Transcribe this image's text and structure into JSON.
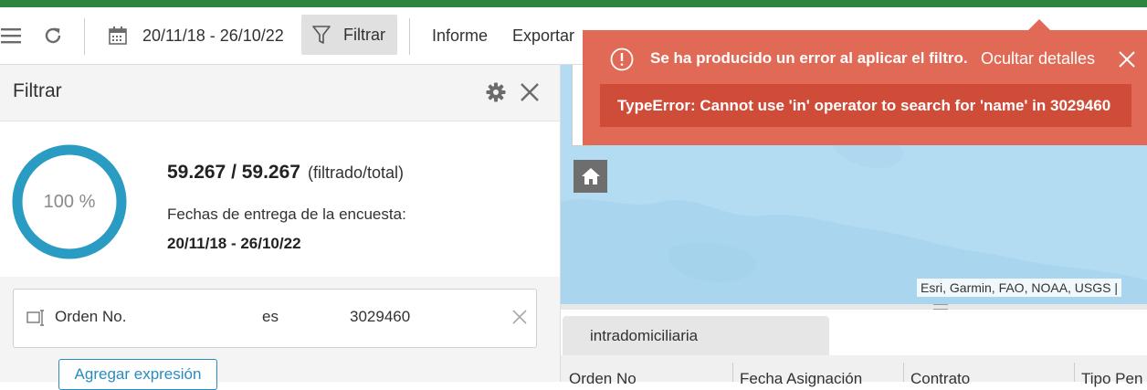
{
  "toolbar": {
    "menu_icon": "hamburger-menu-icon",
    "refresh_icon": "refresh-icon",
    "calendar_icon": "calendar-icon",
    "date_range": "20/11/18 - 26/10/22",
    "filter_icon": "funnel-filter-icon",
    "filter_label": "Filtrar",
    "report_label": "Informe",
    "export_label": "Exportar"
  },
  "filter_panel": {
    "title": "Filtrar",
    "settings_icon": "gear-icon",
    "close_icon": "close-icon",
    "progress_label": "100 %",
    "progress_fraction": 1.0,
    "count_text": "59.267 / 59.267",
    "count_note": "(filtrado/total)",
    "dates_label": "Fechas de entrega de la encuesta:",
    "dates_value": "20/11/18 - 26/10/22",
    "expression": {
      "field_icon": "field-selector-icon",
      "field": "Orden No.",
      "operator": "es",
      "value": "3029460",
      "remove_icon": "close-icon"
    },
    "add_expression_label": "Agregar expresión"
  },
  "map": {
    "home_icon": "home-icon",
    "attribution": "Esri, Garmin, FAO, NOAA, USGS |"
  },
  "table": {
    "tab_label": "intradomiciliaria",
    "columns": [
      "Orden No",
      "Fecha Asignación",
      "Contrato",
      "Tipo Pen"
    ]
  },
  "error_toast": {
    "alert_icon": "exclamation-circle-icon",
    "message": "Se ha producido un error al aplicar el filtro.",
    "hide_details_label": "Ocultar detalles",
    "close_icon": "close-icon",
    "detail": "TypeError: Cannot use 'in' operator to search for 'name' in 3029460"
  },
  "colors": {
    "top_stripe": "#2e8540",
    "progress_ring": "#2a9bc3",
    "toast_bg": "#e06a55",
    "toast_detail_bg": "#cf4c38",
    "map_water": "#b3dcf2"
  }
}
